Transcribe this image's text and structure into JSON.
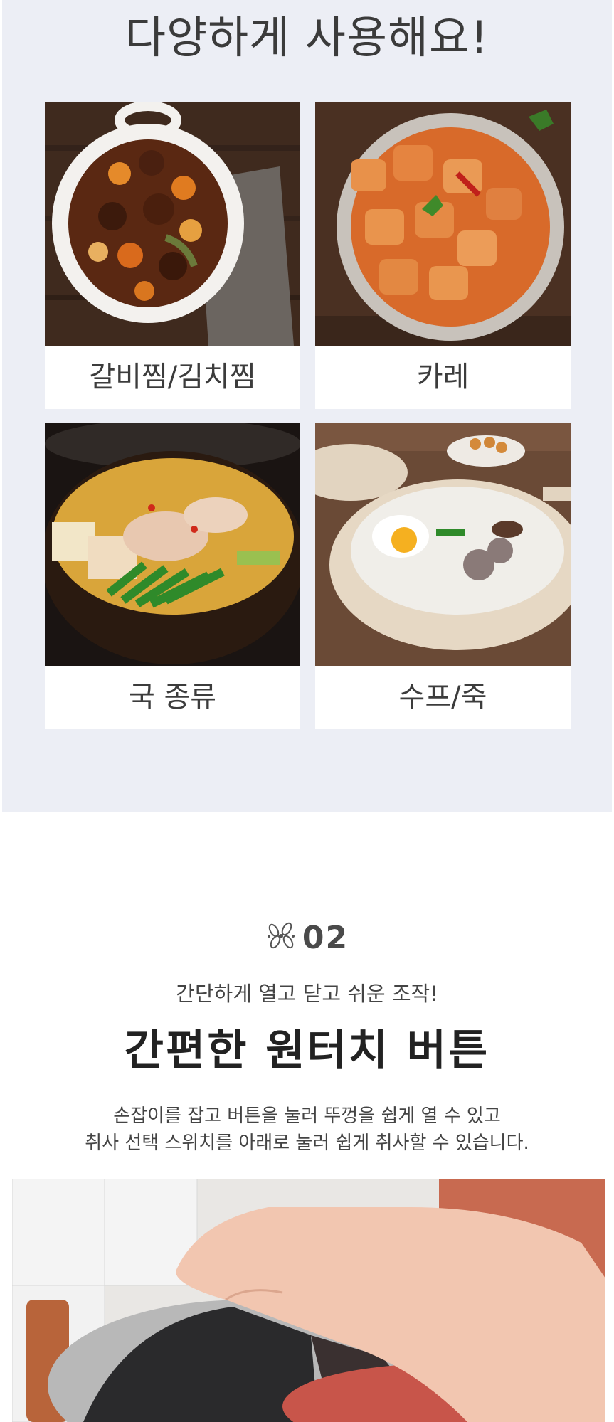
{
  "section1": {
    "headline": "다양하게 사용해요!",
    "cards": [
      {
        "label": "갈비찜/김치찜",
        "photo": "braised-ribs-photo"
      },
      {
        "label": "카레",
        "photo": "curry-photo"
      },
      {
        "label": "국 종류",
        "photo": "hotpot-soup-photo"
      },
      {
        "label": "수프/죽",
        "photo": "porridge-photo"
      }
    ]
  },
  "section2": {
    "step_icon": "leaf-ornament-icon",
    "step_number": "02",
    "subhead": "간단하게 열고 닫고 쉬운 조작!",
    "title": "간편한 원터치 버튼",
    "desc_line1": "손잡이를 잡고 버튼을 눌러 뚜껑을 쉽게 열 수 있고",
    "desc_line2": "취사 선택 스위치를 아래로 눌러 쉽게 취사할 수 있습니다.",
    "photo": "hand-pressing-lid-button-photo"
  },
  "colors": {
    "section_bg": "#eceef5",
    "card_bg": "#ffffff",
    "text_dark": "#222222"
  }
}
